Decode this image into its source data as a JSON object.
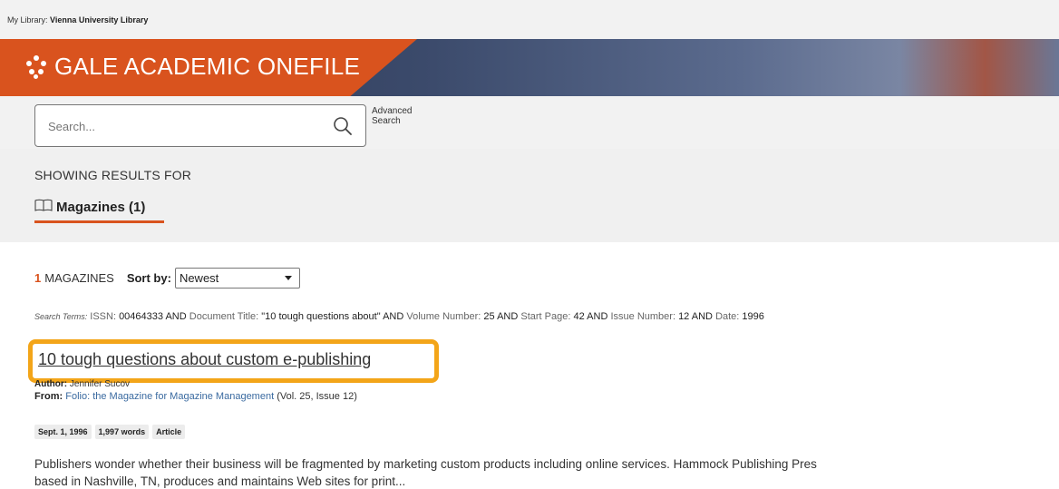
{
  "library": {
    "prefix": "My Library:",
    "name": "Vienna University Library"
  },
  "brand": {
    "title": "GALE ACADEMIC ONEFILE",
    "accent": "#d9531e"
  },
  "search": {
    "placeholder": "Search...",
    "advanced_line1": "Advanced",
    "advanced_line2": "Search"
  },
  "results_for": {
    "label": "SHOWING RESULTS FOR",
    "tab_label": "Magazines",
    "tab_count": "(1)"
  },
  "listing": {
    "count": "1",
    "unit": "MAGAZINES",
    "sort_label": "Sort by:",
    "sort_value": "Newest"
  },
  "search_terms": {
    "label": "Search Terms:",
    "items": [
      {
        "key": "ISSN:",
        "value": "00464333"
      },
      {
        "key": "Document Title:",
        "value": "\"10 tough questions about\""
      },
      {
        "key": "Volume Number:",
        "value": "25"
      },
      {
        "key": "Start Page:",
        "value": "42"
      },
      {
        "key": "Issue Number:",
        "value": "12"
      },
      {
        "key": "Date:",
        "value": "1996"
      }
    ],
    "joiner": "AND"
  },
  "result": {
    "title": "10 tough questions about custom e-publishing",
    "author_label": "Author:",
    "author": "Jennifer Sucov",
    "from_label": "From:",
    "source": "Folio: the Magazine for Magazine Management",
    "source_detail": "(Vol. 25, Issue 12)",
    "badges": [
      "Sept. 1, 1996",
      "1,997 words",
      "Article"
    ],
    "summary_line1": "Publishers wonder whether their business will be fragmented by marketing custom products including online services. Hammock Publishing Pres",
    "summary_line2": "based in Nashville, TN, produces and maintains Web sites for print..."
  },
  "highlight_color": "#f3a519"
}
